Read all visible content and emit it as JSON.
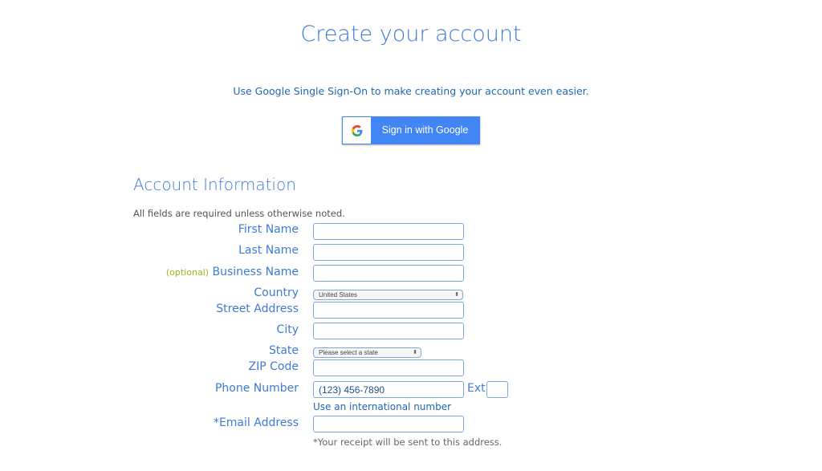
{
  "page": {
    "title": "Create your account",
    "sso_prompt": "Use Google Single Sign-On to make creating your account even easier.",
    "google_button": {
      "label": "Sign in with Google",
      "icon": "google-g-icon"
    }
  },
  "account_info": {
    "heading": "Account Information",
    "note": "All fields are required unless otherwise noted.",
    "fields": {
      "first_name": {
        "label": "First Name",
        "value": ""
      },
      "last_name": {
        "label": "Last Name",
        "value": ""
      },
      "business_name": {
        "optional_tag": "(optional)",
        "label": "Business Name",
        "value": ""
      },
      "country": {
        "label": "Country",
        "selected": "United States"
      },
      "street_address": {
        "label": "Street Address",
        "value": ""
      },
      "city": {
        "label": "City",
        "value": ""
      },
      "state": {
        "label": "State",
        "selected": "Please select a state"
      },
      "zip": {
        "label": "ZIP Code",
        "value": ""
      },
      "phone": {
        "label": "Phone Number",
        "placeholder": "(123) 456-7890",
        "ext_label": "Ext",
        "international_link": "Use an international number"
      },
      "email": {
        "label": "*Email Address",
        "value": "",
        "help": "*Your receipt will be sent to this address."
      }
    }
  }
}
